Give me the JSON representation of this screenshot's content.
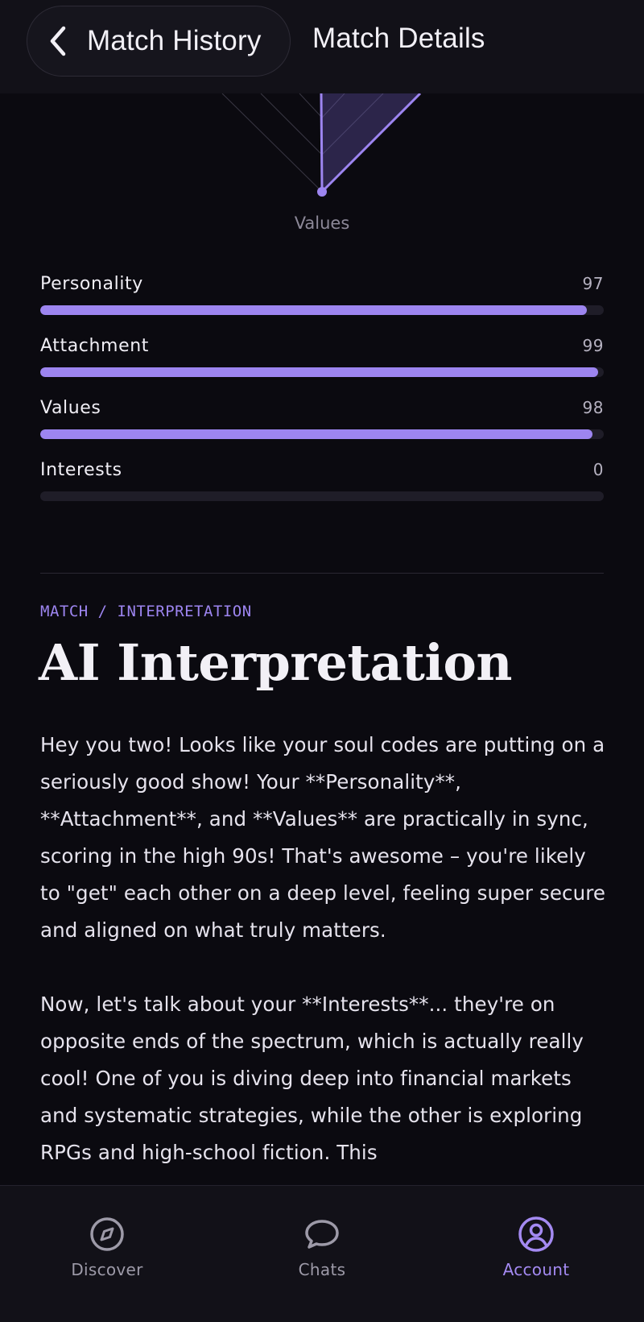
{
  "header": {
    "back_label": "Match History",
    "title": "Match Details"
  },
  "radar": {
    "axis_label": "Values"
  },
  "scores": [
    {
      "label": "Personality",
      "value": 97
    },
    {
      "label": "Attachment",
      "value": 99
    },
    {
      "label": "Values",
      "value": 98
    },
    {
      "label": "Interests",
      "value": 0
    }
  ],
  "interpretation": {
    "eyebrow": "MATCH / INTERPRETATION",
    "title": "AI Interpretation",
    "paragraph_1": "Hey you two! Looks like your soul codes are putting on a seriously good show! Your **Personality**, **Attachment**, and **Values** are practically in sync, scoring in the high 90s! That's awesome – you're likely to \"get\" each other on a deep level, feeling super secure and aligned on what truly matters.",
    "paragraph_2": "Now, let's talk about your **Interests**... they're on opposite ends of the spectrum, which is actually really cool! One of you is diving deep into financial markets and systematic strategies, while the other is exploring RPGs and high-school fiction. This"
  },
  "nav": {
    "items": [
      {
        "label": "Discover",
        "icon": "compass-icon"
      },
      {
        "label": "Chats",
        "icon": "chat-bubble-icon"
      },
      {
        "label": "Account",
        "icon": "user-circle-icon"
      }
    ],
    "active_color": "#a48af2",
    "inactive_color": "#9d9aa8"
  },
  "colors": {
    "accent": "#9d85f0",
    "background": "#0b0a10"
  }
}
